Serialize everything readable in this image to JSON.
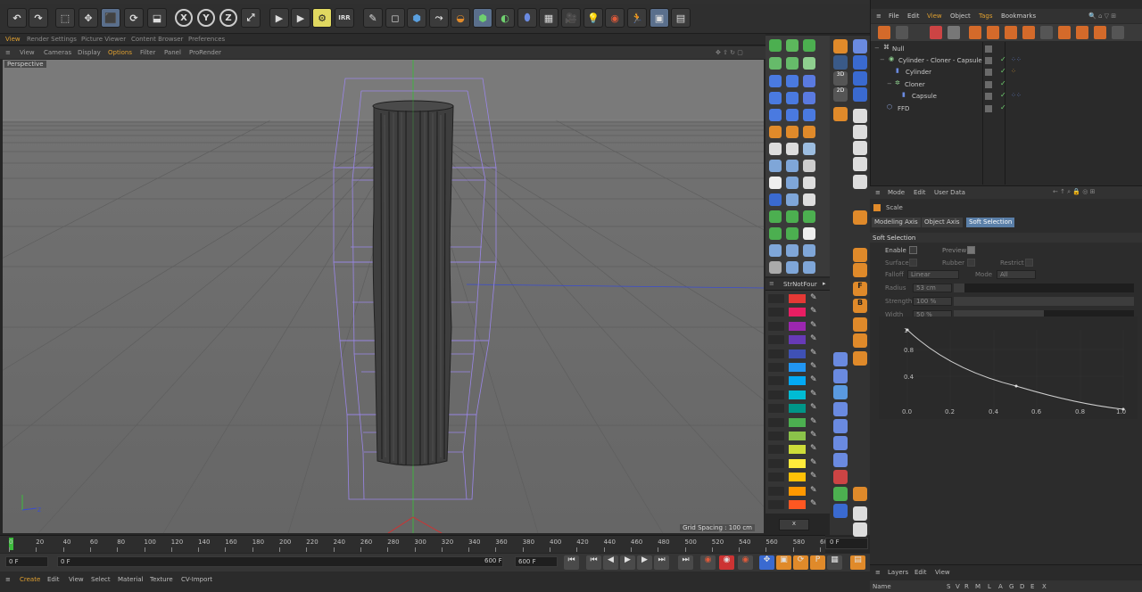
{
  "toolbar": {
    "axis_x": "X",
    "axis_y": "Y",
    "axis_z": "Z",
    "irr": "IRR"
  },
  "tabs": [
    "View",
    "Render Settings",
    "Picture Viewer",
    "Content Browser",
    "Preferences"
  ],
  "viewport_menu": [
    "View",
    "Cameras",
    "Display",
    "Options",
    "Filter",
    "Panel",
    "ProRender"
  ],
  "viewport": {
    "label": "Perspective",
    "grid_spacing": "Grid Spacing : 100 cm"
  },
  "swatch_panel": {
    "title": "StrNotFour",
    "close": "x",
    "colors": [
      "#e53935",
      "#e91e63",
      "#9c27b0",
      "#673ab7",
      "#3f51b5",
      "#2196f3",
      "#03a9f4",
      "#00bcd4",
      "#009688",
      "#4caf50",
      "#8bc34a",
      "#cddc39",
      "#ffeb3b",
      "#ffc107",
      "#ff9800",
      "#ff5722"
    ]
  },
  "object_manager": {
    "menu": [
      "File",
      "Edit",
      "View",
      "Object",
      "Tags",
      "Bookmarks"
    ],
    "objects": [
      {
        "name": "Null"
      },
      {
        "name": "Cylinder - Cloner - Capsule"
      },
      {
        "name": "Cylinder"
      },
      {
        "name": "Cloner"
      },
      {
        "name": "Capsule"
      },
      {
        "name": "FFD"
      }
    ]
  },
  "attribute_manager": {
    "menu": [
      "Mode",
      "Edit",
      "User Data"
    ],
    "object": "Scale",
    "tabs": [
      "Modeling Axis",
      "Object Axis",
      "Soft Selection"
    ],
    "section": "Soft Selection",
    "enable_label": "Enable",
    "preview_label": "Preview",
    "surface_label": "Surface",
    "rubber_label": "Rubber",
    "restrict_label": "Restrict",
    "falloff_label": "Falloff",
    "falloff_value": "Linear",
    "mode_label": "Mode",
    "mode_value": "All",
    "radius_label": "Radius",
    "radius_value": "53 cm",
    "strength_label": "Strength",
    "strength_value": "100 %",
    "width_label": "Width",
    "width_value": "50 %",
    "graph_y": [
      "1",
      "0.8",
      "0.4"
    ],
    "graph_x": [
      "0.0",
      "0.2",
      "0.4",
      "0.6",
      "0.8",
      "1.0"
    ]
  },
  "timeline": {
    "ticks": [
      "0",
      "20",
      "40",
      "60",
      "80",
      "100",
      "120",
      "140",
      "160",
      "180",
      "200",
      "220",
      "240",
      "260",
      "280",
      "300",
      "320",
      "340",
      "360",
      "380",
      "400",
      "420",
      "440",
      "460",
      "480",
      "500",
      "520",
      "540",
      "560",
      "580",
      "600"
    ],
    "current_frame": "0 F"
  },
  "transport": {
    "start": "0 F",
    "current": "0 F",
    "end": "600 F",
    "max": "600 F"
  },
  "bottom_menu": [
    "Create",
    "Edit",
    "View",
    "Select",
    "Material",
    "Texture",
    "CV-Import"
  ],
  "layers": {
    "menu": [
      "Layers",
      "Edit",
      "View"
    ],
    "name_col": "Name",
    "cols": [
      "S",
      "V",
      "R",
      "M",
      "L",
      "A",
      "G",
      "D",
      "E",
      "X"
    ]
  }
}
